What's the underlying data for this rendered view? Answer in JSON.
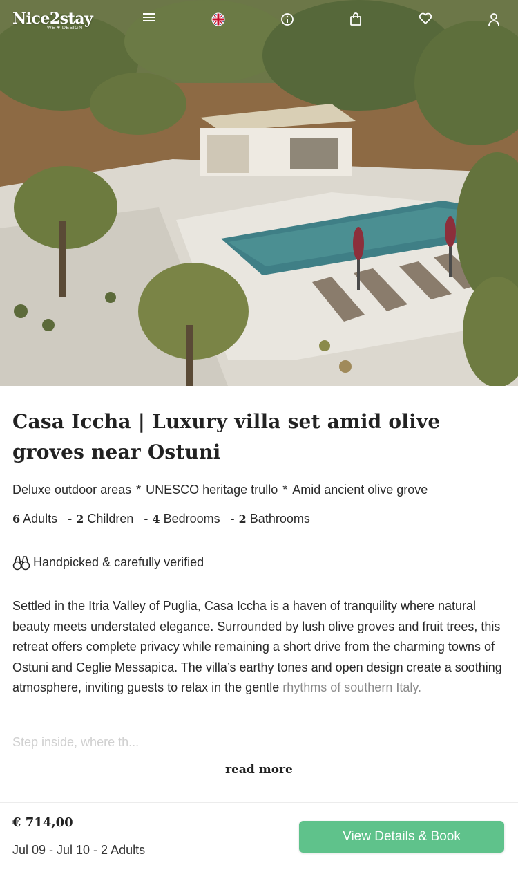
{
  "header": {
    "logo_text": "Nice2stay",
    "logo_sub": "WE ♥ DESIGN",
    "icons": [
      "menu-icon",
      "uk-flag-icon",
      "info-icon",
      "bag-icon",
      "heart-icon",
      "user-icon"
    ]
  },
  "listing": {
    "title": "Casa Iccha | Luxury villa set amid olive groves near Ostuni",
    "features": [
      "Deluxe outdoor areas",
      "UNESCO heritage trullo",
      "Amid ancient olive grove"
    ],
    "feature_separator": "*",
    "adults_count": "6",
    "adults_label": "Adults",
    "children_count": "2",
    "children_label": "Children",
    "bedrooms_count": "4",
    "bedrooms_label": "Bedrooms",
    "bathrooms_count": "2",
    "bathrooms_label": "Bathrooms",
    "verified_text": "Handpicked & carefully verified",
    "description_main": "Settled in the Itria Valley of Puglia, Casa Iccha is a haven of tranquility where natural beauty meets understated elegance. Surrounded by lush olive groves and fruit trees, this retreat offers complete privacy while remaining a short drive from the charming towns of Ostuni and Ceglie Messapica. The villa’s earthy tones and open design create a soothing atmosphere, inviting guests to relax in the gentle",
    "description_fade": "rhythms of southern Italy.",
    "description_preview": "Step inside, where th...",
    "read_more": "read more"
  },
  "booking": {
    "price": "€ 714,00",
    "dates": "Jul 09 - Jul 10 - 2 Adults",
    "button_label": "View Details & Book"
  },
  "colors": {
    "book_button": "#5fc28b",
    "text": "#222222"
  }
}
